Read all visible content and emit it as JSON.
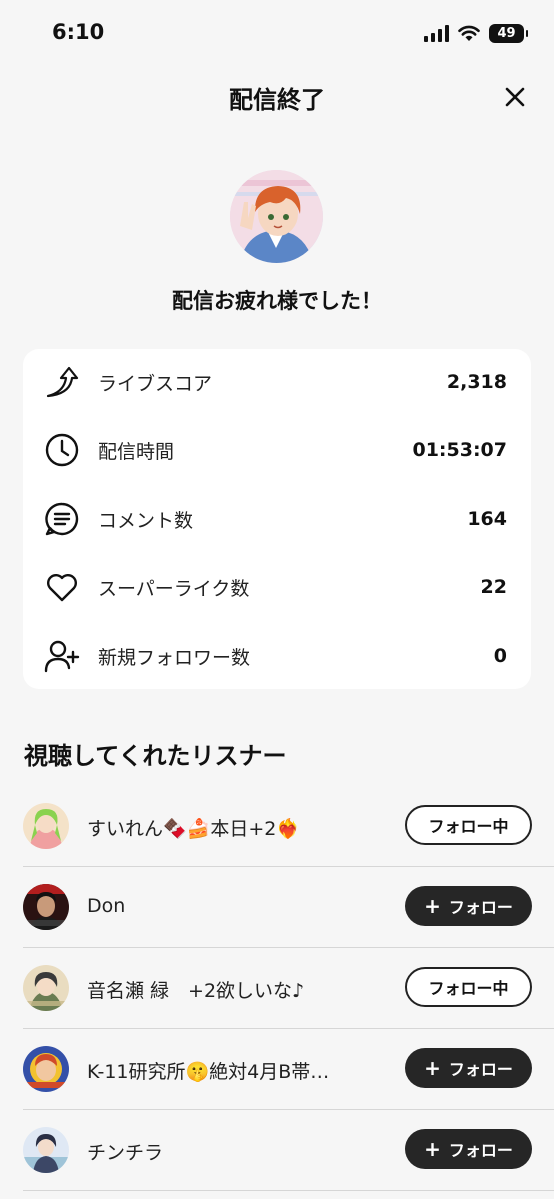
{
  "status_bar": {
    "time": "6:10",
    "battery": "49"
  },
  "header": {
    "title": "配信終了"
  },
  "summary": {
    "message": "配信お疲れ様でした！"
  },
  "stats": [
    {
      "icon": "trend-arrow-icon",
      "label": "ライブスコア",
      "value": "2,318"
    },
    {
      "icon": "clock-icon",
      "label": "配信時間",
      "value": "01:53:07"
    },
    {
      "icon": "comment-icon",
      "label": "コメント数",
      "value": "164"
    },
    {
      "icon": "heart-icon",
      "label": "スーパーライク数",
      "value": "22"
    },
    {
      "icon": "add-user-icon",
      "label": "新規フォロワー数",
      "value": "0"
    }
  ],
  "listeners_section": {
    "title": "視聴してくれたリスナー"
  },
  "listeners": [
    {
      "name": "すいれん🍫🍰本日+2❤️‍🔥",
      "button": "フォロー中",
      "following": true,
      "avatar_color": "#8ad24f"
    },
    {
      "name": "Don",
      "button": "フォロー",
      "following": false,
      "avatar_color": "#3a1a1a"
    },
    {
      "name": "音名瀬 緑　+2欲しいな♪",
      "button": "フォロー中",
      "following": true,
      "avatar_color": "#c7b98a"
    },
    {
      "name": "K-11研究所🤫絶対4月B帯…",
      "button": "フォロー",
      "following": false,
      "avatar_color": "#d04a2a"
    },
    {
      "name": "チンチラ",
      "button": "フォロー",
      "following": false,
      "avatar_color": "#c9d6ea"
    }
  ]
}
